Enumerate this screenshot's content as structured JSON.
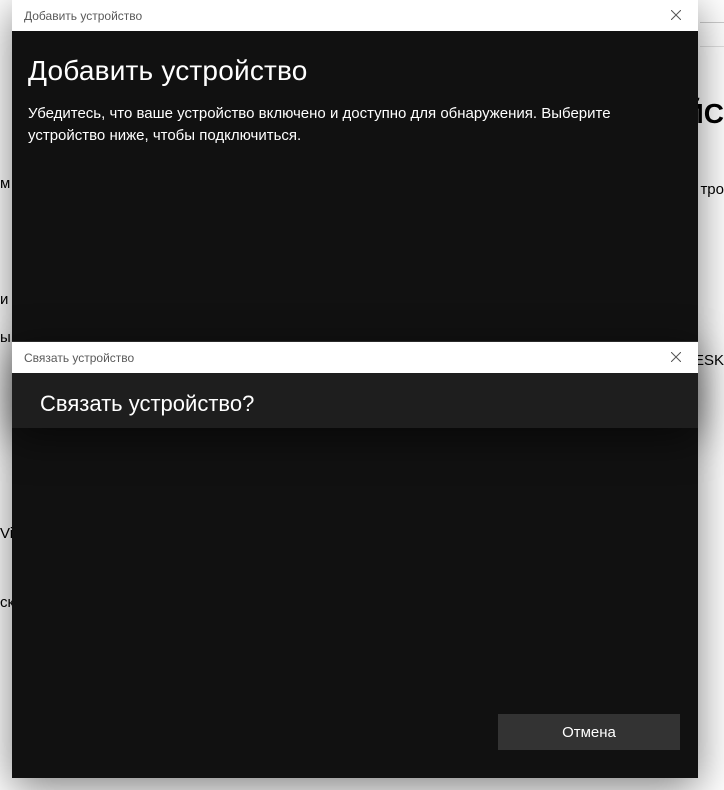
{
  "primaryDialog": {
    "windowTitle": "Добавить устройство",
    "heading": "Добавить устройство",
    "instructions": "Убедитесь, что ваше устройство включено и доступно для обнаружения. Выберите устройство ниже, чтобы подключиться.",
    "cancelLabel": "Отмена"
  },
  "secondaryDialog": {
    "windowTitle": "Связать устройство",
    "heading": "Связать устройство?"
  },
  "backgroundFragments": {
    "f1": "ЙС",
    "f2": "тро",
    "f3": "и",
    "f4": "ы",
    "f5": "ESK",
    "f6": "Vi",
    "f7": "ск",
    "f8": "м"
  }
}
